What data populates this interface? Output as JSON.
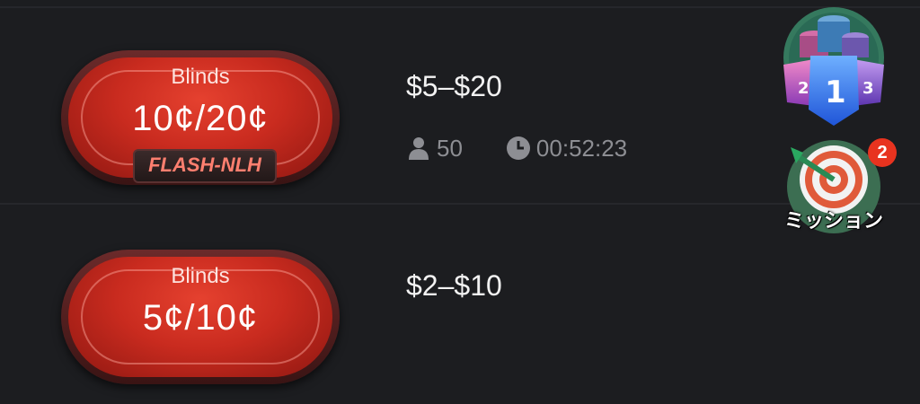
{
  "tables": [
    {
      "blinds_label": "Blinds",
      "blinds_value": "10¢/20¢",
      "game_type": "FLASH-NLH",
      "stakes": "$5–$20",
      "players": "50",
      "time_remaining": "00:52:23"
    },
    {
      "blinds_label": "Blinds",
      "blinds_value": "5¢/10¢",
      "stakes": "$2–$10"
    }
  ],
  "rank_badge": {
    "first": "1",
    "second": "2",
    "third": "3",
    "icon": "leaderboard-chips-icon"
  },
  "mission": {
    "label": "ミッション",
    "count": "2",
    "icon": "target-dart-icon"
  },
  "colors": {
    "background": "#1c1d20",
    "table_red": "#c92b1f",
    "tag_text": "#ff7f6f",
    "meta_gray": "#8d8e93",
    "badge_red": "#e8331f"
  }
}
